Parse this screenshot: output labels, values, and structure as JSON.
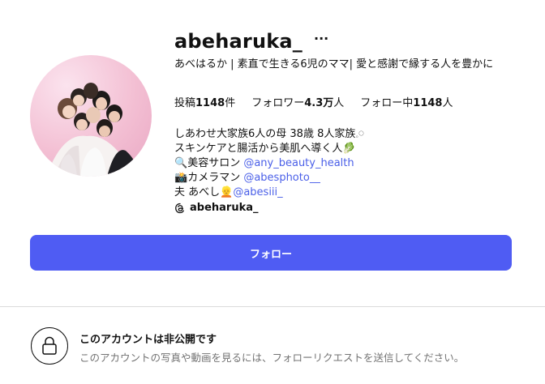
{
  "profile": {
    "username": "abeharuka_",
    "more_label": "···",
    "full_name": "あべはるか | 素直で生きる6児のママ| 愛と感謝で縁する人を豊かに"
  },
  "stats": {
    "posts_label": "投稿",
    "posts_value": "1148",
    "posts_unit": "件",
    "followers_label": "フォロワー",
    "followers_value": "4.3万",
    "followers_unit": "人",
    "following_label": "フォロー中",
    "following_value": "1148",
    "following_unit": "人"
  },
  "bio": {
    "line1": "しあわせ大家族6人の母 38歳 8人家族𓈒𓏸",
    "line2": "スキンケアと腸活から美肌へ導く人🥬",
    "line3_prefix": "美容サロン ",
    "line3_link": "@any_beauty_health",
    "line4_prefix": "カメラマン ",
    "line4_link": "@abesphoto__",
    "line5_prefix": "夫 あべし",
    "line5_link": "@abesiii_",
    "threads_handle": "abeharuka_"
  },
  "follow_button_label": "フォロー",
  "private": {
    "title": "このアカウントは非公開です",
    "description": "このアカウントの写真や動画を見るには、フォローリクエストを送信してください。"
  },
  "colors": {
    "button": "#4f5cf3",
    "link": "#4a5fe8",
    "muted": "#737373"
  },
  "icons": [
    "more-options-icon",
    "magnifier-icon",
    "camera-icon",
    "person-icon",
    "threads-icon",
    "lock-icon"
  ]
}
